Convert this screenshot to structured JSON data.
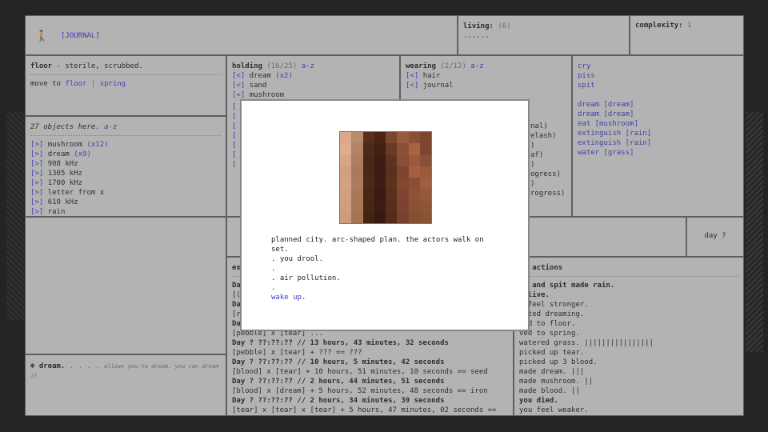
{
  "top": {
    "journal": "[JOURNAL]",
    "living_label": "living:",
    "living_count": "(6)",
    "living_dots": "......",
    "complexity_label": "complexity:",
    "complexity_value": "1"
  },
  "location": {
    "line1_prefix": "floor",
    "line1_rest": " - sterile, scrubbed.",
    "move_to": "move to",
    "dest1": "floor",
    "sep": "|",
    "dest2": "spring"
  },
  "objects": {
    "header": "27 objects here.",
    "sort": "a-z",
    "items": [
      {
        "name": "mushroom",
        "count": "(x12)"
      },
      {
        "name": "dream",
        "count": "(x9)"
      },
      {
        "name": "908 kHz",
        "count": ""
      },
      {
        "name": "1305 kHz",
        "count": ""
      },
      {
        "name": "1700 kHz",
        "count": ""
      },
      {
        "name": "letter from x",
        "count": ""
      },
      {
        "name": "610 kHz",
        "count": ""
      },
      {
        "name": "rain",
        "count": ""
      }
    ]
  },
  "holding": {
    "label": "holding",
    "count": "(16/25)",
    "sort": "a-z",
    "items": [
      {
        "name": "dream",
        "count": "(x2)"
      },
      {
        "name": "sand",
        "count": ""
      },
      {
        "name": "mushroom",
        "count": ""
      }
    ]
  },
  "wearing": {
    "label": "wearing",
    "count": "(2/12)",
    "sort": "a-z",
    "items": [
      {
        "name": "hair"
      },
      {
        "name": "journal"
      }
    ],
    "partial": [
      "nal)",
      "elash)",
      ")",
      "af)",
      ")",
      "ogress)",
      ")",
      "rogress)"
    ]
  },
  "verbs": {
    "basic": [
      "cry",
      "piss",
      "spit"
    ],
    "combos": [
      "dream [dream]",
      "dream [dream]",
      "eat [mushroom]",
      "extinguish [rain]",
      "extinguish [rain]",
      "water [grass]"
    ]
  },
  "day_label": "day ?",
  "experiments": {
    "label_partial": "ex",
    "lines": [
      {
        "text": "Da",
        "bold": true
      },
      {
        "text": "[(",
        "bold": false
      },
      {
        "text": "Da",
        "bold": true
      },
      {
        "text": "[r",
        "bold": false
      },
      {
        "text": "Da",
        "bold": true
      },
      {
        "text": "[pebble] x [tear] ...",
        "bold": false
      },
      {
        "text": "Day ? ??:??:?? // 13 hours, 43 minutes, 32 seconds",
        "bold": true
      },
      {
        "text": "[pebble] x [tear] + ??? == ???",
        "bold": false
      },
      {
        "text": "Day ? ??:??:?? // 10 hours, 5 minutes, 42 seconds",
        "bold": true
      },
      {
        "text": "[blood] x [tear] + 10 hours, 51 minutes, 10 seconds == seed",
        "bold": false
      },
      {
        "text": "Day ? ??:??:?? // 2 hours, 44 minutes, 51 seconds",
        "bold": true
      },
      {
        "text": "[blood] x [dream] + 5 hours, 52 minutes, 48 seconds == iron",
        "bold": false
      },
      {
        "text": "Day ? ??:??:?? // 2 hours, 34 minutes, 39 seconds",
        "bold": true
      },
      {
        "text": "[tear] x [tear] x [tear] + 5 hours, 47 minutes, 02 seconds ==",
        "bold": false
      }
    ]
  },
  "recent": {
    "label_partial": "st actions",
    "lines": [
      {
        "text": "it and spit made rain.",
        "bold": true
      },
      {
        "text": "u live.",
        "bold": true
      },
      {
        "text": "u feel stronger.",
        "bold": false
      },
      {
        "text": "arted dreaming.",
        "bold": false
      },
      {
        "text": "ved to floor.",
        "bold": false
      },
      {
        "text": "ved to spring.",
        "bold": false
      },
      {
        "text": "watered grass. ||||||||||||||||",
        "bold": false
      },
      {
        "text": "picked up tear.",
        "bold": false
      },
      {
        "text": "picked up 3 blood.",
        "bold": false
      },
      {
        "text": "made dream. |||",
        "bold": false
      },
      {
        "text": "made mushroom. ||",
        "bold": false
      },
      {
        "text": "made blood. ||",
        "bold": false
      },
      {
        "text": "you died.",
        "bold": true
      },
      {
        "text": "you feel weaker.",
        "bold": false
      }
    ]
  },
  "dream_info": {
    "name": "dream.",
    "dots": " . . . .",
    "desc": "allows you to dream. you can dream it."
  },
  "modal": {
    "lines": [
      {
        "text": "planned city. arc-shaped plan. the actors walk on set.",
        "link": false
      },
      {
        "text": ". you drool.",
        "link": false
      },
      {
        "text": ".",
        "link": false
      },
      {
        "text": ". air pollution.",
        "link": false
      },
      {
        "text": ".",
        "link": false
      }
    ],
    "wake": "wake up",
    "wake_tail": "."
  },
  "colors": {
    "link": "#3b3bd6",
    "pixels": [
      "#d9a98a",
      "#b98a6b",
      "#5a2e1c",
      "#4b2416",
      "#7a4630",
      "#9a5a3e",
      "#8a5036",
      "#7a4630",
      "#dcae8e",
      "#b48366",
      "#4e2818",
      "#432014",
      "#6a3a26",
      "#8c5036",
      "#a56444",
      "#7e4630",
      "#d6a686",
      "#ae7e60",
      "#4a2616",
      "#3e1d12",
      "#5e3220",
      "#8a4e34",
      "#9c5a3c",
      "#86503a",
      "#d2a080",
      "#aa7a5c",
      "#4a2818",
      "#3c1c12",
      "#5a301e",
      "#7e4630",
      "#a46040",
      "#9a5a3c",
      "#d4a282",
      "#ac7c5e",
      "#4c2818",
      "#3e1e12",
      "#5c321e",
      "#84482e",
      "#8a5034",
      "#9e5e40",
      "#d0a080",
      "#a87858",
      "#4a2616",
      "#3a1a10",
      "#58301c",
      "#7e4630",
      "#8e5238",
      "#96583a",
      "#cf9e7e",
      "#a67656",
      "#482614",
      "#3a1c10",
      "#562e1c",
      "#7a4430",
      "#8a5036",
      "#8e5438",
      "#cc9c7c",
      "#a47454",
      "#462414",
      "#381a10",
      "#542c1a",
      "#784230",
      "#86502f",
      "#8a5236"
    ]
  }
}
